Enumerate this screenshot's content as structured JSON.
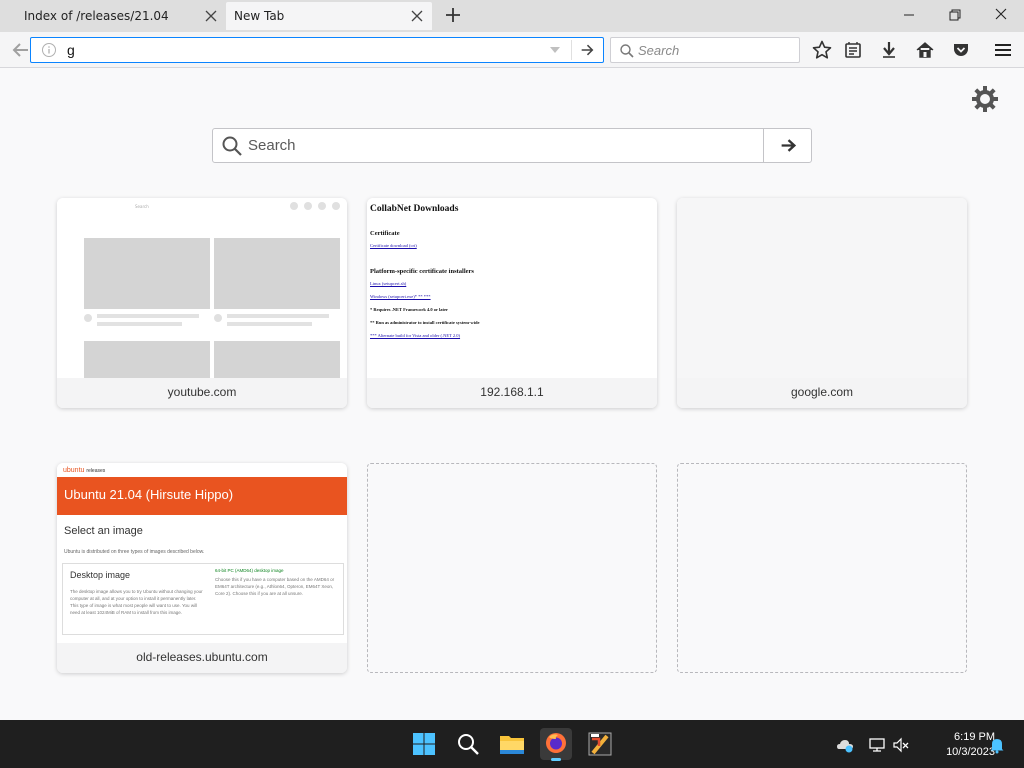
{
  "browser": {
    "tabs": [
      {
        "title": "Index of /releases/21.04",
        "active": false
      },
      {
        "title": "New Tab",
        "active": true
      }
    ],
    "url_value": "g",
    "search_placeholder": "Search"
  },
  "newtab": {
    "search_placeholder": "Search",
    "top_sites": [
      {
        "label": "youtube.com"
      },
      {
        "label": "192.168.1.1"
      },
      {
        "label": "google.com"
      },
      {
        "label": "old-releases.ubuntu.com"
      }
    ],
    "youtube_thumb": {
      "search_text": "Search"
    },
    "collabnet_thumb": {
      "title": "CollabNet Downloads",
      "section1": "Certificate",
      "link1": "Certificate download (crt)",
      "section2": "Platform-specific certificate installers",
      "link2": "Linux (setupcert.sh)",
      "link3": "Windows (setupcert.exe)* ** ***",
      "note1": "* Requires .NET Framework 4.0 or later",
      "note2": "** Run as administrator to install certificate system-wide",
      "link4": "*** Alternate build for Vista and older (.NET 2.0)"
    },
    "ubuntu_thumb": {
      "brand": "ubuntu",
      "brand_suffix": "releases",
      "banner_title": "Ubuntu 21.04 (Hirsute Hippo)",
      "heading": "Select an image",
      "intro": "Ubuntu is distributed on three types of images described below.",
      "card_title": "Desktop image",
      "card_text": "The desktop image allows you to try Ubuntu without changing your computer at all, and at your option to install it permanently later. This type of image is what most people will want to use. You will need at least 1024MiB of RAM to install from this image.",
      "card_link": "64-bit PC (AMD64) desktop image",
      "card_text2": "Choose this if you have a computer based on the AMD64 or EM64T architecture (e.g., Athlon64, Opteron, EM64T Xeon, Core 2). Choose this if you are at all unsure."
    }
  },
  "taskbar": {
    "time": "6:19 PM",
    "date": "10/3/2023"
  },
  "colors": {
    "accent": "#0a84ff",
    "ubuntu_orange": "#e95420",
    "taskbar": "#1f1f1f"
  }
}
